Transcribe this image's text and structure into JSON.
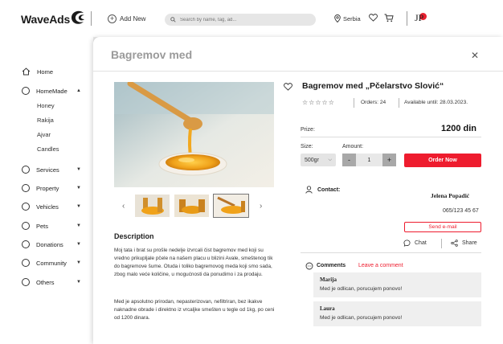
{
  "header": {
    "logo": "WaveAds",
    "add_new": "Add New",
    "search_placeholder": "Search by name, tag, ad...",
    "location": "Serbia",
    "user_initials": "JP"
  },
  "sidebar": {
    "items": [
      {
        "label": "Home"
      },
      {
        "label": "HomeMade"
      },
      {
        "label": "Services"
      },
      {
        "label": "Property"
      },
      {
        "label": "Vehicles"
      },
      {
        "label": "Pets"
      },
      {
        "label": "Donations"
      },
      {
        "label": "Community"
      },
      {
        "label": "Others"
      }
    ],
    "subitems": [
      "Honey",
      "Rakija",
      "Ajvar",
      "Candles"
    ]
  },
  "modal": {
    "title": "Bagremov med",
    "product_title": "Bagremov med „Pčelarstvo Slović“",
    "orders": "Orders: 24",
    "available": "Available until: 28.03.2023.",
    "prize_label": "Prize:",
    "prize_value": "1200 din",
    "size_label": "Size:",
    "size_value": "500gr",
    "amount_label": "Amount:",
    "qty_minus": "-",
    "qty_value": "1",
    "qty_plus": "+",
    "order_button": "Order Now",
    "contact_label": "Contact:",
    "contact_name": "Jelena Popadić",
    "contact_phone": "065/123 45 67",
    "send_email": "Send e-mail",
    "chat": "Chat",
    "share": "Share",
    "description_heading": "Description",
    "description_p1": "Moj tata i brat su prošle nedelje izvrcali čist bagremov med koji su vredno prikupljale pčele na našem placu u blizini Avale, smeštenog tik do bagremove šume. Otuda i toliko bagremovog meda koji smo sada, zbog malo veće količine, u mogućnosti da ponudimo i za prodaju.",
    "description_p2": "Med je apsolutno prirodan, nepasterizovan, nefiltriran, bez ikakve naknadne obrade i direktno iz vrcaljke smešten u tegle od 1kg, po ceni od 1200 dinara.",
    "comments_label": "Comments",
    "leave_comment": "Leave a comment",
    "comments": [
      {
        "name": "Marija",
        "text": "Med je odlican, porucujem ponovo!"
      },
      {
        "name": "Laura",
        "text": "Med je odlican, porucujem ponovo!"
      }
    ],
    "rating_stars": 0
  },
  "colors": {
    "accent": "#ee1c2e",
    "modal_title": "#9a9a9a",
    "background": "#ececec"
  }
}
